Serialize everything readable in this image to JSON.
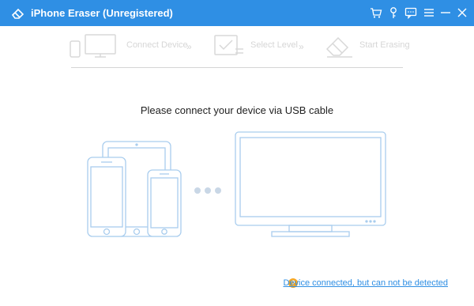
{
  "window": {
    "title": "iPhone Eraser (Unregistered)",
    "accent_color": "#2f8fe4",
    "titlebar_buttons": [
      {
        "name": "cart-icon",
        "glyph": "🛒"
      },
      {
        "name": "key-icon",
        "glyph": "⚲"
      },
      {
        "name": "feedback-icon",
        "glyph": "▭"
      },
      {
        "name": "menu-icon",
        "glyph": "≡"
      },
      {
        "name": "minimize-icon",
        "glyph": "—"
      },
      {
        "name": "close-icon",
        "glyph": "✕"
      }
    ]
  },
  "steps": [
    {
      "label": "Connect Device",
      "icon": "devices-icon"
    },
    {
      "label": "Select Level",
      "icon": "checklist-icon"
    },
    {
      "label": "Start Erasing",
      "icon": "eraser-icon"
    }
  ],
  "step_separator": "»",
  "main": {
    "prompt": "Please connect your device via USB cable"
  },
  "status": {
    "icon": "?",
    "link_text": "Device connected, but can not be detected"
  }
}
